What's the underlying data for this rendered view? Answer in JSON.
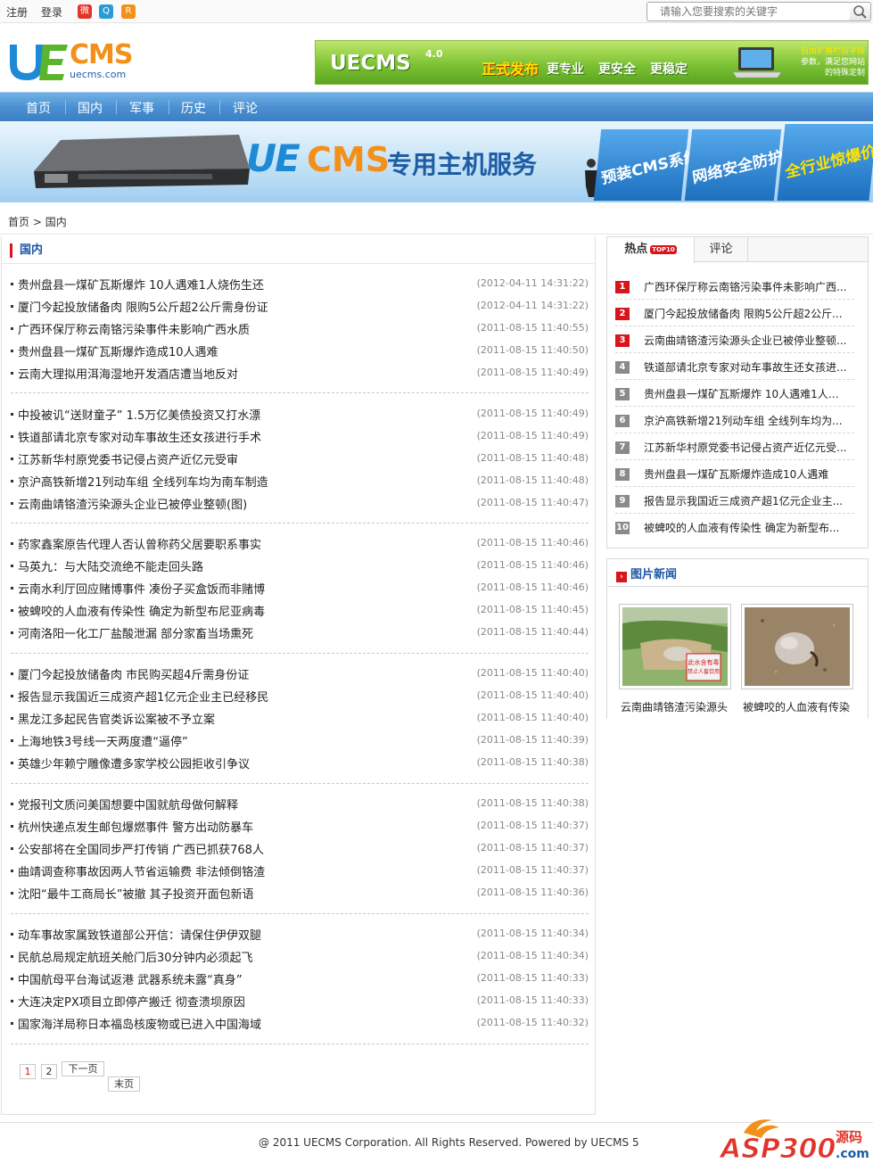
{
  "topbar": {
    "register": "注册",
    "login": "登录",
    "search_placeholder": "请输入您要搜索的关键字"
  },
  "header": {
    "logo_text": "CMS",
    "logo_mark": "UE",
    "logo_domain": "uecms.com",
    "banner": {
      "title": "UECMS",
      "version": "4.0",
      "headline": "正式发布",
      "slogans": [
        "更专业",
        "更安全",
        "更稳定"
      ],
      "extra_line1": "自由扩展栏目字段",
      "extra_line2": "参数，满足您网站",
      "extra_line3": "的特殊定制"
    }
  },
  "nav": {
    "items": [
      "首页",
      "国内",
      "军事",
      "历史",
      "评论"
    ]
  },
  "big_banner": {
    "brand_mark": "UE",
    "brand": "CMS",
    "service": "专用主机服务",
    "badges": [
      "预装CMS系统",
      "网络安全防护",
      "全行业惊爆价"
    ]
  },
  "breadcrumb": {
    "home": "首页",
    "separator": ">",
    "current": "国内"
  },
  "main": {
    "section_title": "国内",
    "groups": [
      [
        {
          "title": "贵州盘县一煤矿瓦斯爆炸  10人遇难1人烧伤生还",
          "date": "(2012-04-11 14:31:22)"
        },
        {
          "title": "厦门今起投放储备肉  限购5公斤超2公斤需身份证",
          "date": "(2012-04-11 14:31:22)"
        },
        {
          "title": "广西环保厅称云南铬污染事件未影响广西水质",
          "date": "(2011-08-15 11:40:55)"
        },
        {
          "title": "贵州盘县一煤矿瓦斯爆炸造成10人遇难",
          "date": "(2011-08-15 11:40:50)"
        },
        {
          "title": "云南大理拟用洱海湿地开发酒店遭当地反对",
          "date": "(2011-08-15 11:40:49)"
        }
      ],
      [
        {
          "title": "中投被讥“送财童子”  1.5万亿美债投资又打水漂",
          "date": "(2011-08-15 11:40:49)"
        },
        {
          "title": "铁道部请北京专家对动车事故生还女孩进行手术",
          "date": "(2011-08-15 11:40:49)"
        },
        {
          "title": "江苏新华村原党委书记侵占资产近亿元受审",
          "date": "(2011-08-15 11:40:48)"
        },
        {
          "title": "京沪高铁新增21列动车组  全线列车均为南车制造",
          "date": "(2011-08-15 11:40:48)"
        },
        {
          "title": "云南曲靖铬渣污染源头企业已被停业整顿(图)",
          "date": "(2011-08-15 11:40:47)"
        }
      ],
      [
        {
          "title": "药家鑫案原告代理人否认曾称药父居要职系事实",
          "date": "(2011-08-15 11:40:46)"
        },
        {
          "title": "马英九：与大陆交流绝不能走回头路",
          "date": "(2011-08-15 11:40:46)"
        },
        {
          "title": "云南水利厅回应赌博事件  凑份子买盒饭而非赌博",
          "date": "(2011-08-15 11:40:46)"
        },
        {
          "title": "被蜱咬的人血液有传染性  确定为新型布尼亚病毒",
          "date": "(2011-08-15 11:40:45)"
        },
        {
          "title": "河南洛阳一化工厂盐酸泄漏  部分家畜当场熏死",
          "date": "(2011-08-15 11:40:44)"
        }
      ],
      [
        {
          "title": "厦门今起投放储备肉  市民购买超4斤需身份证",
          "date": "(2011-08-15 11:40:40)"
        },
        {
          "title": "报告显示我国近三成资产超1亿元企业主已经移民",
          "date": "(2011-08-15 11:40:40)"
        },
        {
          "title": "黑龙江多起民告官类诉讼案被不予立案",
          "date": "(2011-08-15 11:40:40)"
        },
        {
          "title": "上海地铁3号线一天两度遭“逼停”",
          "date": "(2011-08-15 11:40:39)"
        },
        {
          "title": "英雄少年赖宁雕像遭多家学校公园拒收引争议",
          "date": "(2011-08-15 11:40:38)"
        }
      ],
      [
        {
          "title": "党报刊文质问美国想要中国就航母做何解释",
          "date": "(2011-08-15 11:40:38)"
        },
        {
          "title": "杭州快递点发生邮包爆燃事件  警方出动防暴车",
          "date": "(2011-08-15 11:40:37)"
        },
        {
          "title": "公安部将在全国同步严打传销  广西已抓获768人",
          "date": "(2011-08-15 11:40:37)"
        },
        {
          "title": "曲靖调查称事故因两人节省运输费  非法倾倒铬渣",
          "date": "(2011-08-15 11:40:37)"
        },
        {
          "title": "沈阳“最牛工商局长”被撤  其子投资开面包新语",
          "date": "(2011-08-15 11:40:36)"
        }
      ],
      [
        {
          "title": "动车事故家属致铁道部公开信：请保住伊伊双腿",
          "date": "(2011-08-15 11:40:34)"
        },
        {
          "title": "民航总局规定航班关舱门后30分钟内必须起飞",
          "date": "(2011-08-15 11:40:34)"
        },
        {
          "title": "中国航母平台海试返港  武器系统未露“真身”",
          "date": "(2011-08-15 11:40:33)"
        },
        {
          "title": "大连决定PX项目立即停产搬迁  彻查溃坝原因",
          "date": "(2011-08-15 11:40:33)"
        },
        {
          "title": "国家海洋局称日本福岛核废物或已进入中国海域",
          "date": "(2011-08-15 11:40:32)"
        }
      ]
    ],
    "pagination": {
      "pages": [
        "1",
        "2"
      ],
      "current": "1",
      "next": "下一页",
      "last": "末页"
    }
  },
  "sidebar": {
    "tabs": {
      "hot": "热点",
      "hot_badge": "TOP10",
      "comment": "评论"
    },
    "hot_list": [
      {
        "rank": "1",
        "title": "广西环保厅称云南铬污染事件未影响广西..."
      },
      {
        "rank": "2",
        "title": "厦门今起投放储备肉  限购5公斤超2公斤..."
      },
      {
        "rank": "3",
        "title": "云南曲靖铬渣污染源头企业已被停业整顿..."
      },
      {
        "rank": "4",
        "title": "铁道部请北京专家对动车事故生还女孩进..."
      },
      {
        "rank": "5",
        "title": "贵州盘县一煤矿瓦斯爆炸  10人遇难1人烧..."
      },
      {
        "rank": "6",
        "title": "京沪高铁新增21列动车组  全线列车均为..."
      },
      {
        "rank": "7",
        "title": "江苏新华村原党委书记侵占资产近亿元受..."
      },
      {
        "rank": "8",
        "title": "贵州盘县一煤矿瓦斯爆炸造成10人遇难"
      },
      {
        "rank": "9",
        "title": "报告显示我国近三成资产超1亿元企业主..."
      },
      {
        "rank": "10",
        "title": "被蜱咬的人血液有传染性  确定为新型布..."
      }
    ],
    "rank_colors": {
      "top3": "#d7151a",
      "rest": "#8a8a8a"
    },
    "pic_news": {
      "title": "图片新闻",
      "items": [
        {
          "caption": "云南曲靖铬渣污染源头",
          "sign_line1": "此水含有毒",
          "sign_line2": "禁止人畜饮用"
        },
        {
          "caption": "被蜱咬的人血液有传染"
        }
      ]
    }
  },
  "footer": {
    "copyright": "@ 2011 UECMS Corporation. All Rights Reserved. Powered by UECMS 5",
    "watermark_brand": "ASP300",
    "watermark_sub": "源码",
    "watermark_domain": ".com"
  },
  "colors": {
    "nav_blue": "#4b90d2",
    "link_blue": "#1c55a5",
    "accent_red": "#d7151a",
    "banner_green": "#7dc234"
  }
}
